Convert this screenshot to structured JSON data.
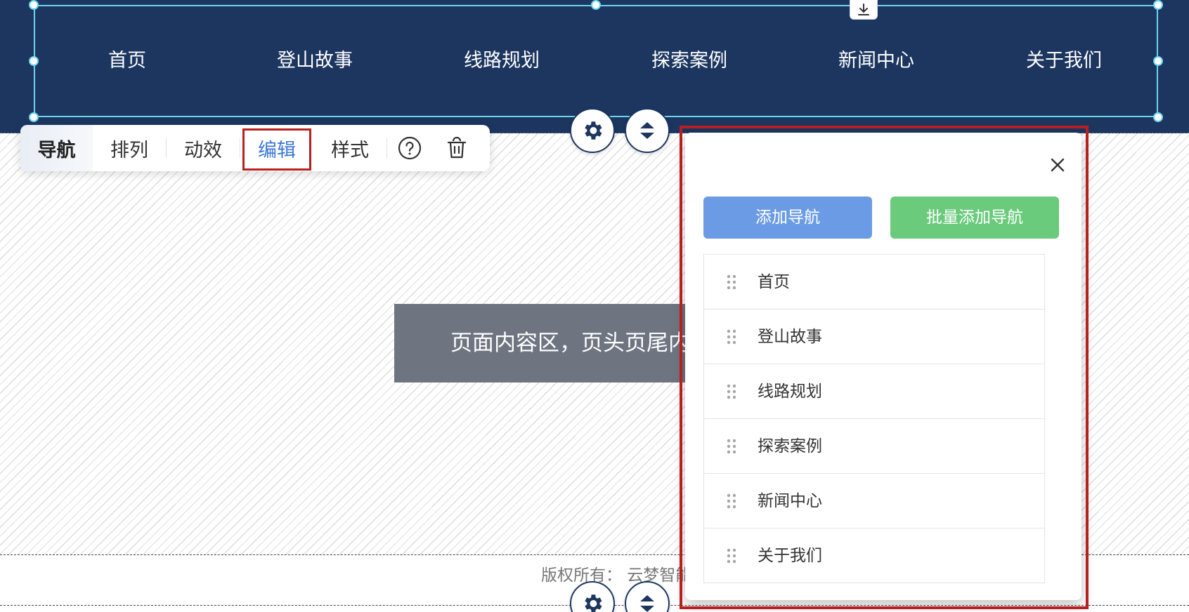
{
  "header": {
    "nav_items": [
      "首页",
      "登山故事",
      "线路规划",
      "探索案例",
      "新闻中心",
      "关于我们"
    ]
  },
  "toolbar": {
    "items": [
      "导航",
      "排列",
      "动效",
      "编辑",
      "样式"
    ],
    "active": "导航",
    "selected": "编辑",
    "help_icon": "question-circle-icon",
    "delete_icon": "trash-icon"
  },
  "main": {
    "placeholder_text": "页面内容区，页头页尾内"
  },
  "footer": {
    "copyright": "版权所有： 云梦智能"
  },
  "panel": {
    "add_label": "添加导航",
    "batch_label": "批量添加导航",
    "items": [
      "首页",
      "登山故事",
      "线路规划",
      "探索案例",
      "新闻中心",
      "关于我们"
    ]
  },
  "colors": {
    "header_bg": "#1c3660",
    "selection": "#6cd4ec",
    "highlight": "#b8201f",
    "primary_button": "#6c9be6",
    "success_button": "#6acb7c",
    "active_text": "#3d78d8"
  }
}
